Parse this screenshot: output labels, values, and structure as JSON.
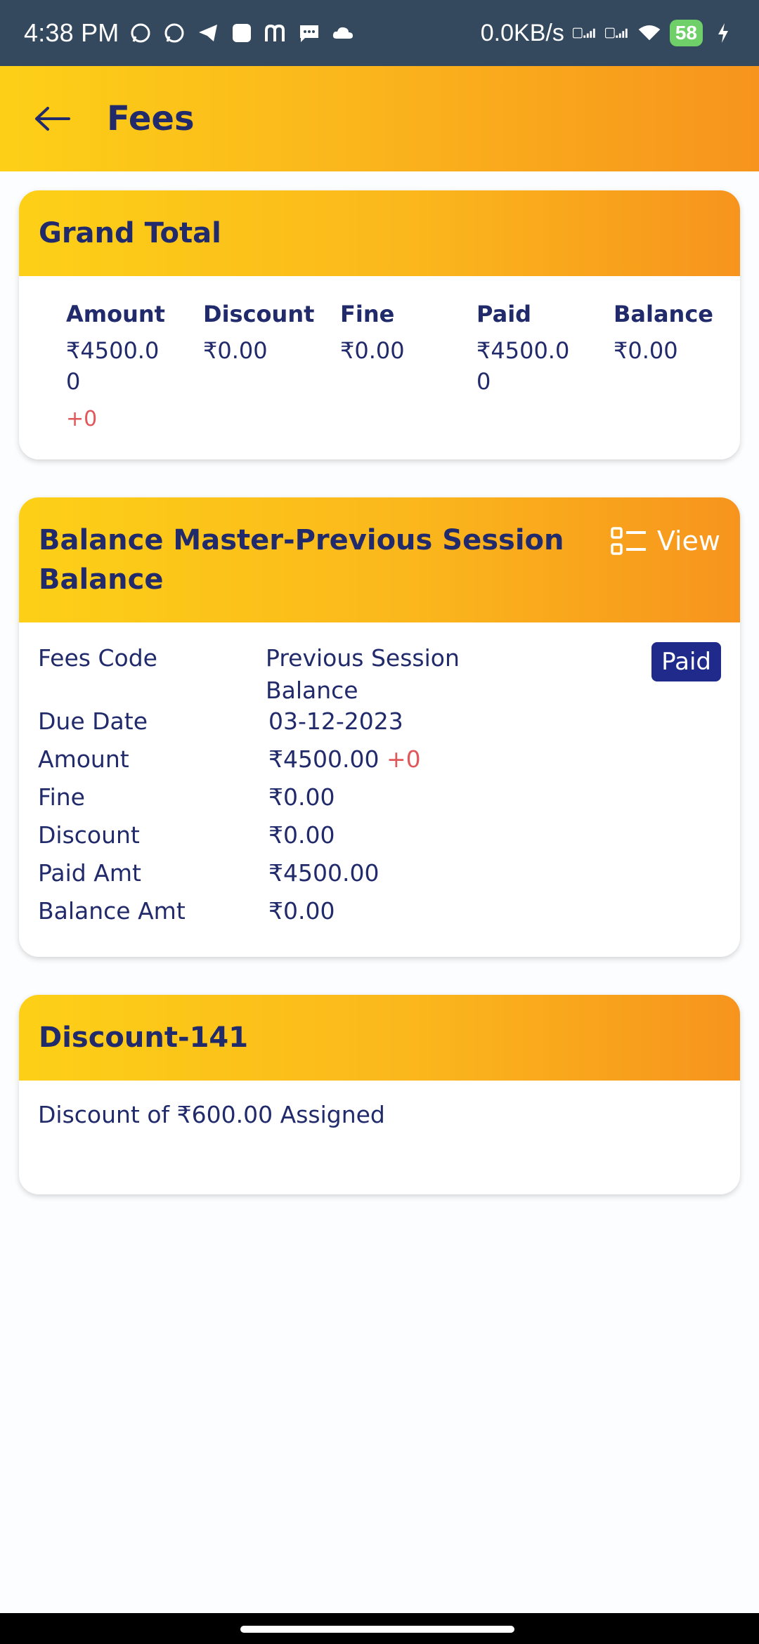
{
  "status_bar": {
    "time": "4:38 PM",
    "net_speed": "0.0KB/s",
    "battery": "58"
  },
  "app_bar": {
    "title": "Fees"
  },
  "grand_total": {
    "title": "Grand Total",
    "columns": [
      {
        "header": "Amount",
        "value": "₹4500.00",
        "extra": "+0"
      },
      {
        "header": "Discount",
        "value": "₹0.00"
      },
      {
        "header": "Fine",
        "value": "₹0.00"
      },
      {
        "header": "Paid",
        "value": "₹4500.00"
      },
      {
        "header": "Balance",
        "value": "₹0.00"
      }
    ]
  },
  "balance_master": {
    "title": "Balance Master-Previous Session Balance",
    "view_label": "View",
    "status": "Paid",
    "rows": [
      {
        "label": "Fees Code",
        "value": "Previous Session Balance"
      },
      {
        "label": "Due Date",
        "value": "03-12-2023"
      },
      {
        "label": "Amount",
        "value": "₹4500.00",
        "extra": "+0"
      },
      {
        "label": "Fine",
        "value": "₹0.00"
      },
      {
        "label": "Discount",
        "value": "₹0.00"
      },
      {
        "label": "Paid Amt",
        "value": "₹4500.00"
      },
      {
        "label": "Balance Amt",
        "value": "₹0.00"
      }
    ]
  },
  "discount": {
    "title": "Discount-141",
    "text": "Discount of ₹600.00 Assigned"
  },
  "colors": {
    "header_gradient_start": "#fdd017",
    "header_gradient_end": "#f7941d",
    "text_navy": "#212a6b",
    "accent_red": "#e0585a",
    "paid_badge": "#1f2a8a",
    "status_bar": "#34495e"
  },
  "icons": [
    "whatsapp-icon",
    "telegram-icon",
    "message-icon",
    "cloud-icon",
    "signal-icon",
    "wifi-icon",
    "charging-icon",
    "back-arrow-icon",
    "list-view-icon"
  ]
}
